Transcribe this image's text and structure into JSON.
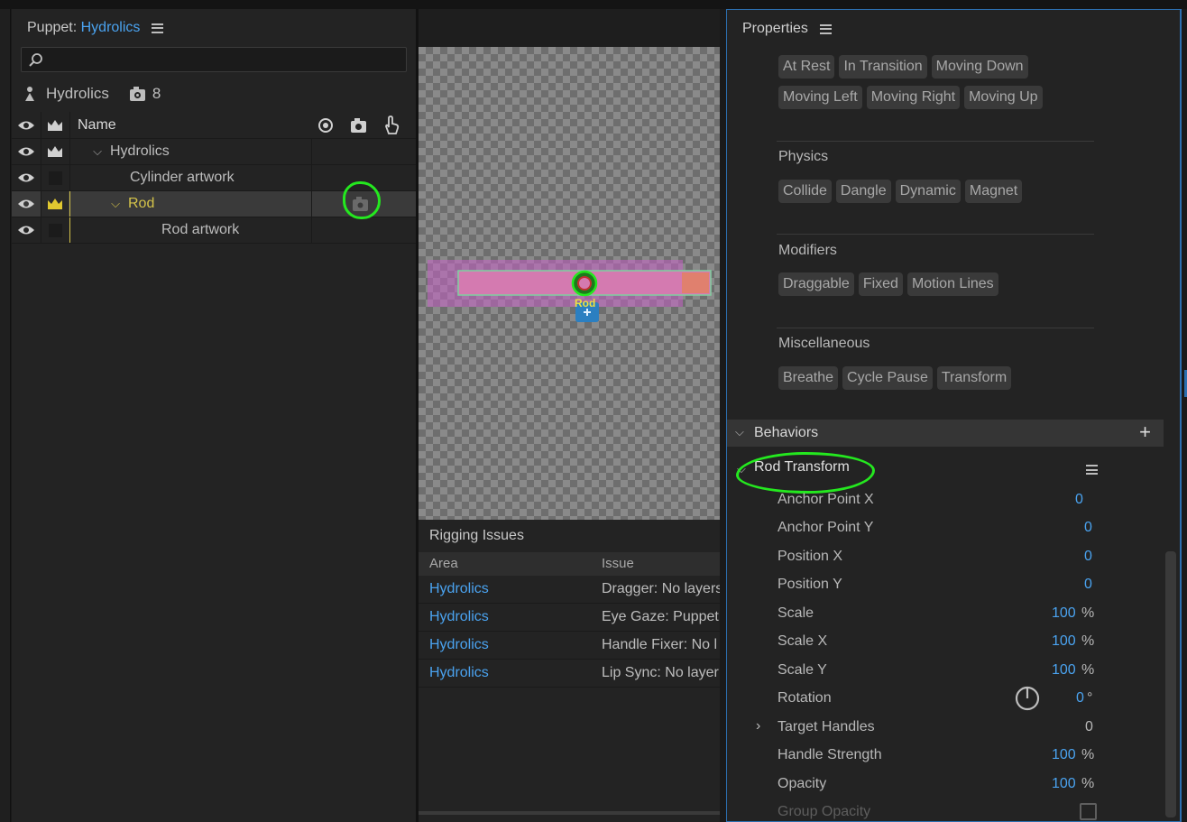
{
  "puppet_panel": {
    "title_prefix": "Puppet:",
    "title_name": "Hydrolics",
    "search_placeholder": "",
    "puppet_name": "Hydrolics",
    "behavior_count": "8",
    "columns": {
      "name": "Name"
    },
    "layers": [
      {
        "name": "Hydrolics",
        "indent": 1,
        "expanded": true,
        "crown": true,
        "selected": false,
        "yellow": false
      },
      {
        "name": "Cylinder artwork",
        "indent": 3,
        "expanded": null,
        "crown": false,
        "selected": false,
        "yellow": false
      },
      {
        "name": "Rod",
        "indent": 2,
        "expanded": true,
        "crown": true,
        "selected": true,
        "yellow": true
      },
      {
        "name": "Rod artwork",
        "indent": 5,
        "expanded": null,
        "crown": false,
        "selected": false,
        "yellow": false
      }
    ]
  },
  "scene": {
    "handle_label": "Rod"
  },
  "rigging": {
    "title": "Rigging Issues",
    "col_area": "Area",
    "col_issue": "Issue",
    "rows": [
      {
        "area": "Hydrolics",
        "issue": "Dragger: No layers"
      },
      {
        "area": "Hydrolics",
        "issue": "Eye Gaze: Puppet"
      },
      {
        "area": "Hydrolics",
        "issue": "Handle Fixer: No l"
      },
      {
        "area": "Hydrolics",
        "issue": "Lip Sync: No layer"
      }
    ]
  },
  "properties": {
    "title": "Properties",
    "tag_rows_top": [
      [
        "At Rest",
        "In Transition",
        "Moving Down"
      ],
      [
        "Moving Left",
        "Moving Right",
        "Moving Up"
      ]
    ],
    "groups": {
      "physics": {
        "title": "Physics",
        "tags": [
          "Collide",
          "Dangle",
          "Dynamic",
          "Magnet"
        ]
      },
      "modifiers": {
        "title": "Modifiers",
        "tags": [
          "Draggable",
          "Fixed",
          "Motion Lines"
        ]
      },
      "misc": {
        "title": "Miscellaneous",
        "tags": [
          "Breathe",
          "Cycle Pause",
          "Transform"
        ]
      }
    },
    "behaviors_label": "Behaviors",
    "behavior_title": "Rod Transform",
    "params": [
      {
        "label": "Anchor Point X",
        "value": "0",
        "unit": ""
      },
      {
        "label": "Anchor Point Y",
        "value": "0",
        "unit": ""
      },
      {
        "label": "Position X",
        "value": "0",
        "unit": ""
      },
      {
        "label": "Position Y",
        "value": "0",
        "unit": ""
      },
      {
        "label": "Scale",
        "value": "100",
        "unit": "%"
      },
      {
        "label": "Scale X",
        "value": "100",
        "unit": "%"
      },
      {
        "label": "Scale Y",
        "value": "100",
        "unit": "%"
      },
      {
        "label": "Rotation",
        "value": "0",
        "unit": "°"
      },
      {
        "label": "Target Handles",
        "value": "0",
        "unit": ""
      },
      {
        "label": "Handle Strength",
        "value": "100",
        "unit": "%"
      },
      {
        "label": "Opacity",
        "value": "100",
        "unit": "%"
      },
      {
        "label": "Group Opacity",
        "value": "",
        "unit": ""
      }
    ],
    "colors": {
      "accent": "#4aa3f0",
      "highlight": "#24e81f",
      "selected_layer": "#d4c34a"
    }
  }
}
